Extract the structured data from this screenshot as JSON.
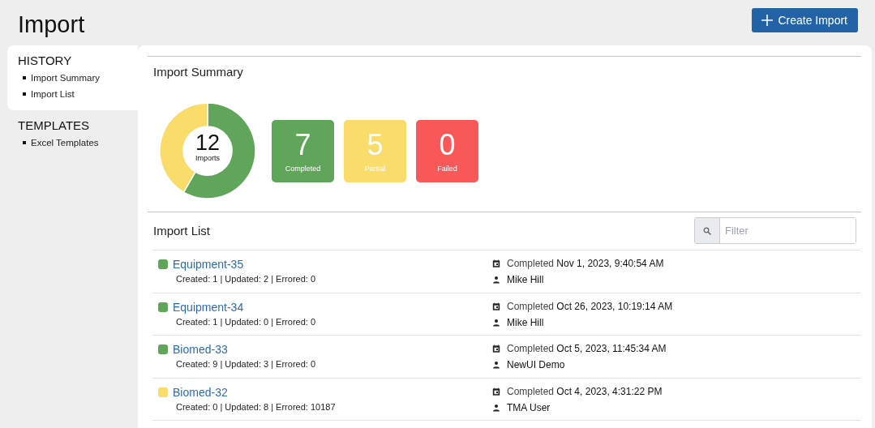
{
  "page": {
    "title": "Import",
    "create_button": "Create Import"
  },
  "sidebar": [
    {
      "heading": "HISTORY",
      "selected": true,
      "items": [
        "Import Summary",
        "Import List"
      ]
    },
    {
      "heading": "TEMPLATES",
      "selected": false,
      "items": [
        "Excel Templates"
      ]
    }
  ],
  "summary": {
    "title": "Import Summary",
    "total": "12",
    "total_label": "Imports",
    "tiles": [
      {
        "count": "7",
        "label": "Completed",
        "color": "#5fa65b"
      },
      {
        "count": "5",
        "label": "Partial",
        "color": "#f9dc6a"
      },
      {
        "count": "0",
        "label": "Failed",
        "color": "#f95858"
      }
    ]
  },
  "import_list": {
    "title": "Import List",
    "filter": {
      "placeholder": "Filter"
    },
    "rows": [
      {
        "name": "Equipment-35",
        "color": "#5fa65b",
        "stats": "Created: 1 | Updated: 2 | Errored: 0",
        "status": "Completed",
        "date": "Nov 1, 2023, 9:40:54 AM",
        "user": "Mike Hill"
      },
      {
        "name": "Equipment-34",
        "color": "#5fa65b",
        "stats": "Created: 1 | Updated: 0 | Errored: 0",
        "status": "Completed",
        "date": "Oct 26, 2023, 10:19:14 AM",
        "user": "Mike Hill"
      },
      {
        "name": "Biomed-33",
        "color": "#5fa65b",
        "stats": "Created: 9 | Updated: 3 | Errored: 0",
        "status": "Completed",
        "date": "Oct 5, 2023, 11:45:34 AM",
        "user": "NewUI Demo"
      },
      {
        "name": "Biomed-32",
        "color": "#f9dc6a",
        "stats": "Created: 0 | Updated: 8 | Errored: 10187",
        "status": "Completed",
        "date": "Oct 4, 2023, 4:31:22 PM",
        "user": "TMA User"
      }
    ]
  }
}
